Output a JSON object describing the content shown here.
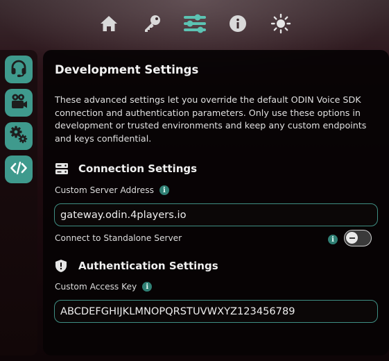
{
  "nav": {
    "items": [
      {
        "name": "home-icon",
        "active": false
      },
      {
        "name": "key-icon",
        "active": false
      },
      {
        "name": "sliders-icon",
        "active": true
      },
      {
        "name": "info-icon",
        "active": false
      },
      {
        "name": "brightness-icon",
        "active": false
      }
    ]
  },
  "sidebar": {
    "items": [
      {
        "name": "headset-icon"
      },
      {
        "name": "video-camera-icon"
      },
      {
        "name": "gears-icon"
      },
      {
        "name": "code-icon"
      }
    ],
    "accent": "#3f9a8d"
  },
  "page": {
    "title": "Development Settings",
    "description": "These advanced settings let you override the default ODIN Voice SDK connection and authentication parameters. Only use these options in development or trusted environments and keep any custom endpoints and keys confidential."
  },
  "connection": {
    "heading": "Connection Settings",
    "server_label": "Custom Server Address",
    "server_value": "gateway.odin.4players.io",
    "standalone_label": "Connect to Standalone Server",
    "standalone_enabled": false
  },
  "authentication": {
    "heading": "Authentication Settings",
    "key_label": "Custom Access Key",
    "key_value": "ABCDEFGHIJKLMNOPQRSTUVWXYZ123456789"
  },
  "info_glyph": "i",
  "colors": {
    "accent": "#3f8f84",
    "active_icon": "#5cc3b3"
  }
}
